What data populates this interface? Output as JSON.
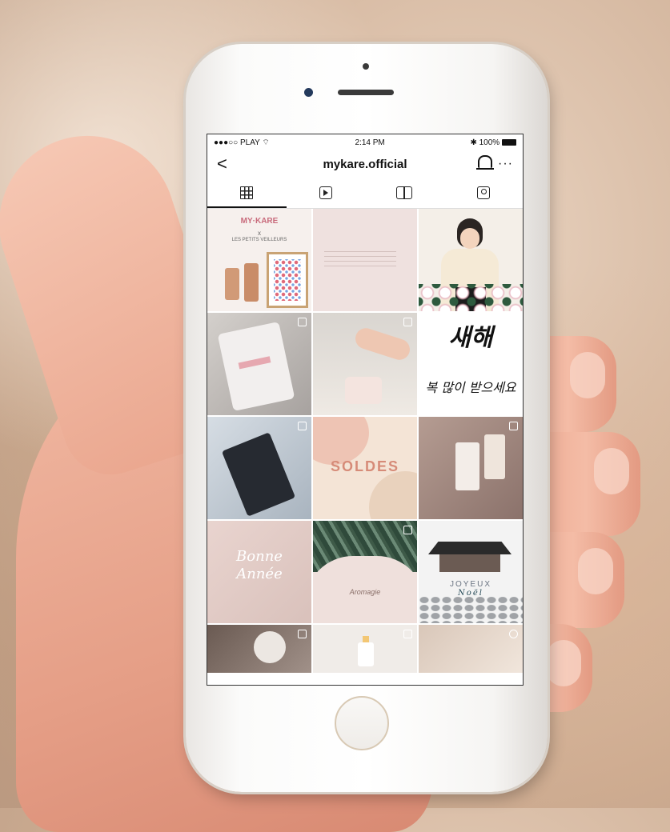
{
  "status_bar": {
    "carrier": "●●●○○ PLAY",
    "wifi_icon": "wifi-icon",
    "time": "2:14 PM",
    "bluetooth": "✱",
    "battery": "100%"
  },
  "header": {
    "back_glyph": "<",
    "username": "mykare.official",
    "more_glyph": "···"
  },
  "tabs": [
    {
      "icon": "grid-icon",
      "active": true
    },
    {
      "icon": "reels-icon",
      "active": false
    },
    {
      "icon": "guide-icon",
      "active": false
    },
    {
      "icon": "tagged-icon",
      "active": false
    }
  ],
  "posts": {
    "p1": {
      "brand": "MY·KARE",
      "x": "x",
      "collab": "LES PETITS VEILLEURS"
    },
    "p6": {
      "line1": "새해",
      "line2": "복 많이 받으세요"
    },
    "p8": {
      "label": "SOLDES"
    },
    "p10": {
      "line1": "Bonne",
      "line2": "Année"
    },
    "p11": {
      "script": "Aromagie"
    },
    "p12": {
      "text1": "JOYEUX",
      "text2": "Noël"
    }
  }
}
